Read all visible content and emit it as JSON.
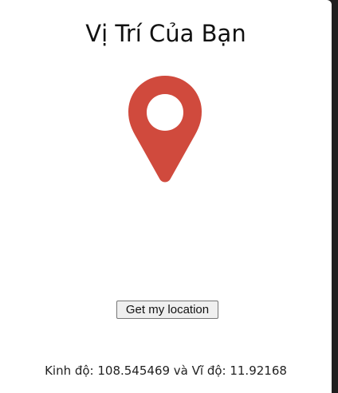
{
  "page": {
    "title": "Vị Trí Của Bạn"
  },
  "marker": {
    "icon": "map-pin-icon",
    "color": "#d04a3d"
  },
  "location_button": {
    "label": "Get my location"
  },
  "coordinates": {
    "text": "Kinh độ: 108.545469 và Vĩ độ: 11.92168"
  }
}
